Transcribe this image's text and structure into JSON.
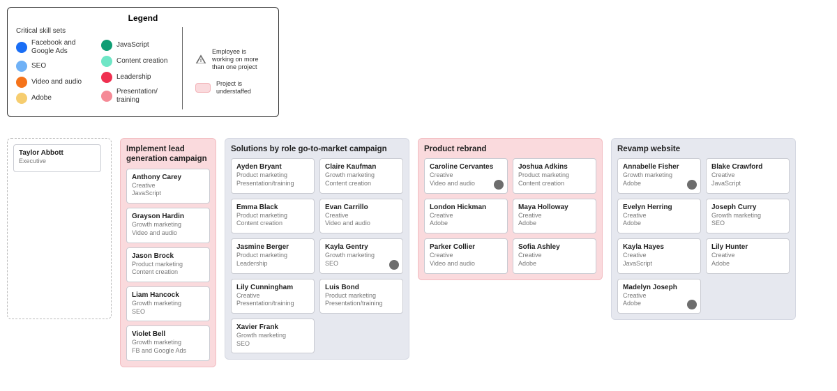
{
  "legend": {
    "title": "Legend",
    "heading": "Critical skill sets",
    "skills_col1": [
      {
        "label": "Facebook and Google Ads",
        "color": "#1a6ef5"
      },
      {
        "label": "SEO",
        "color": "#6fb1f6"
      },
      {
        "label": "Video and audio",
        "color": "#f5731a"
      },
      {
        "label": "Adobe",
        "color": "#f6cd6f"
      }
    ],
    "skills_col2": [
      {
        "label": "JavaScript",
        "color": "#0f9d74"
      },
      {
        "label": "Content creation",
        "color": "#6fe6c6"
      },
      {
        "label": "Leadership",
        "color": "#ef3050"
      },
      {
        "label": "Presentation/ training",
        "color": "#f58a96"
      }
    ],
    "note_warning": "Employee is working on more than one project",
    "note_understaffed": "Project is understaffed"
  },
  "unassigned": {
    "cards": [
      {
        "name": "Taylor Abbott",
        "role": "Executive",
        "skill": ""
      }
    ]
  },
  "groups": [
    {
      "title": "Implement lead generation campaign",
      "understaffed": true,
      "columns": 1,
      "cards": [
        {
          "name": "Anthony Carey",
          "role": "Creative",
          "skill": "JavaScript"
        },
        {
          "name": "Grayson Hardin",
          "role": "Growth marketing",
          "skill": "Video and audio"
        },
        {
          "name": "Jason Brock",
          "role": "Product marketing",
          "skill": "Content creation"
        },
        {
          "name": "Liam Hancock",
          "role": "Growth marketing",
          "skill": "SEO"
        },
        {
          "name": "Violet Bell",
          "role": "Growth marketing",
          "skill": "FB and Google Ads"
        }
      ]
    },
    {
      "title": "Solutions by role go-to-market campaign",
      "understaffed": false,
      "columns": 2,
      "cards": [
        {
          "name": "Ayden Bryant",
          "role": "Product marketing",
          "skill": "Presentation/training"
        },
        {
          "name": "Claire Kaufman",
          "role": "Growth marketing",
          "skill": "Content creation"
        },
        {
          "name": "Emma Black",
          "role": "Product marketing",
          "skill": "Content creation"
        },
        {
          "name": "Evan Carrillo",
          "role": "Creative",
          "skill": "Video and audio"
        },
        {
          "name": "Jasmine Berger",
          "role": "Product marketing",
          "skill": "Leadership"
        },
        {
          "name": "Kayla Gentry",
          "role": "Growth marketing",
          "skill": "SEO",
          "badge": true
        },
        {
          "name": "Lily Cunningham",
          "role": "Creative",
          "skill": "Presentation/training"
        },
        {
          "name": "Luis Bond",
          "role": "Product marketing",
          "skill": "Presentation/training"
        },
        {
          "name": "Xavier Frank",
          "role": "Growth marketing",
          "skill": "SEO"
        }
      ]
    },
    {
      "title": "Product rebrand",
      "understaffed": true,
      "columns": 2,
      "cards": [
        {
          "name": "Caroline Cervantes",
          "role": "Creative",
          "skill": "Video and audio",
          "badge": true
        },
        {
          "name": "Joshua Adkins",
          "role": "Product marketing",
          "skill": "Content creation"
        },
        {
          "name": "London Hickman",
          "role": "Creative",
          "skill": "Adobe"
        },
        {
          "name": "Maya Holloway",
          "role": "Creative",
          "skill": "Adobe"
        },
        {
          "name": "Parker Collier",
          "role": "Creative",
          "skill": "Video and audio"
        },
        {
          "name": "Sofia Ashley",
          "role": "Creative",
          "skill": "Adobe"
        }
      ]
    },
    {
      "title": "Revamp website",
      "understaffed": false,
      "columns": 2,
      "cards": [
        {
          "name": "Annabelle Fisher",
          "role": "Growth marketing",
          "skill": "Adobe",
          "badge": true
        },
        {
          "name": "Blake Crawford",
          "role": "Creative",
          "skill": "JavaScript"
        },
        {
          "name": "Evelyn Herring",
          "role": "Creative",
          "skill": "Adobe"
        },
        {
          "name": "Joseph Curry",
          "role": "Growth marketing",
          "skill": "SEO"
        },
        {
          "name": "Kayla Hayes",
          "role": "Creative",
          "skill": "JavaScript"
        },
        {
          "name": "Lily Hunter",
          "role": "Creative",
          "skill": "Adobe"
        },
        {
          "name": "Madelyn Joseph",
          "role": "Creative",
          "skill": "Adobe",
          "badge": true
        }
      ]
    }
  ]
}
